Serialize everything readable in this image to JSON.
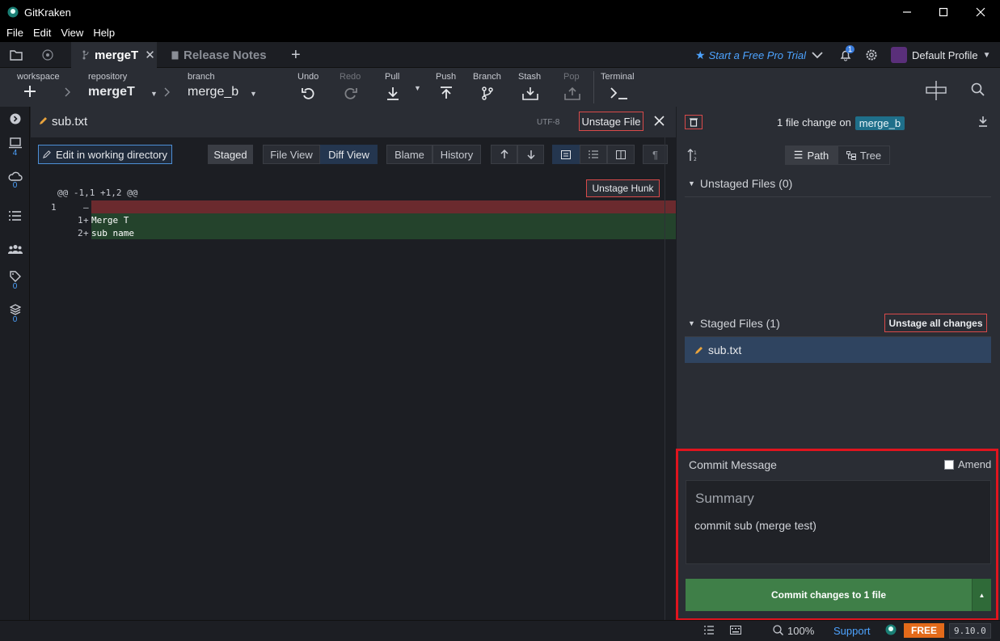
{
  "app": {
    "title": "GitKraken"
  },
  "menu": [
    "File",
    "Edit",
    "View",
    "Help"
  ],
  "tabs": {
    "repo_tab": "mergeT",
    "release_tab": "Release Notes",
    "trial": "Start a Free Pro Trial",
    "notification_count": "1",
    "profile": "Default Profile"
  },
  "toolbar": {
    "workspace_label": "workspace",
    "repository_label": "repository",
    "repository_value": "mergeT",
    "branch_label": "branch",
    "branch_value": "merge_b",
    "undo": "Undo",
    "redo": "Redo",
    "pull": "Pull",
    "push": "Push",
    "branch": "Branch",
    "stash": "Stash",
    "pop": "Pop",
    "terminal": "Terminal"
  },
  "rail": {
    "local_count": "4",
    "remote_count": "0",
    "tags_count": "0",
    "submodules_count": "0"
  },
  "diff": {
    "filename": "sub.txt",
    "encoding": "UTF-8",
    "unstage_file": "Unstage File",
    "edit_in_wd": "Edit in working directory",
    "staged": "Staged",
    "file_view": "File View",
    "diff_view": "Diff View",
    "blame": "Blame",
    "history": "History",
    "hunk_header": "@@ -1,1 +1,2 @@",
    "unstage_hunk": "Unstage Hunk",
    "lines": [
      {
        "old": "1",
        "new": "",
        "sign": "—",
        "text": "",
        "type": "removed"
      },
      {
        "old": "",
        "new": "1",
        "sign": "+",
        "text": "Merge T",
        "type": "added"
      },
      {
        "old": "",
        "new": "2",
        "sign": "+",
        "text": "sub name",
        "type": "added"
      }
    ]
  },
  "right": {
    "change_prefix": "1 file change on",
    "branch": "merge_b",
    "path_btn": "Path",
    "tree_btn": "Tree",
    "unstaged_header": "Unstaged Files (0)",
    "staged_header": "Staged Files (1)",
    "unstage_all": "Unstage all changes",
    "staged_file": "sub.txt"
  },
  "commit": {
    "title": "Commit Message",
    "amend": "Amend",
    "summary_placeholder": "Summary",
    "description": "commit sub (merge test)",
    "commit_button": "Commit changes to 1 file"
  },
  "status": {
    "zoom": "100%",
    "support": "Support",
    "plan": "FREE",
    "version": "9.10.0"
  }
}
